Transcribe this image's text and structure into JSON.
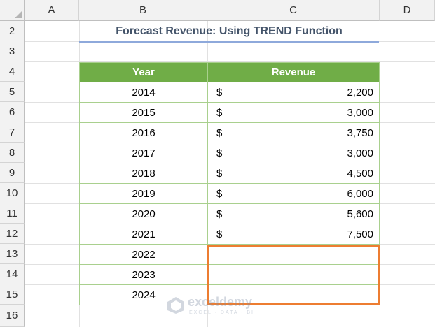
{
  "sheet": {
    "columns": [
      "A",
      "B",
      "C",
      "D"
    ],
    "rows": [
      "2",
      "3",
      "4",
      "5",
      "6",
      "7",
      "8",
      "9",
      "10",
      "11",
      "12",
      "13",
      "14",
      "15",
      "16"
    ]
  },
  "title": "Forecast Revenue: Using TREND Function",
  "table": {
    "headers": {
      "year": "Year",
      "revenue": "Revenue"
    },
    "currency_symbol": "$",
    "rows": [
      {
        "year": "2014",
        "revenue": "2,200"
      },
      {
        "year": "2015",
        "revenue": "3,000"
      },
      {
        "year": "2016",
        "revenue": "3,750"
      },
      {
        "year": "2017",
        "revenue": "3,000"
      },
      {
        "year": "2018",
        "revenue": "4,500"
      },
      {
        "year": "2019",
        "revenue": "6,000"
      },
      {
        "year": "2020",
        "revenue": "5,600"
      },
      {
        "year": "2021",
        "revenue": "7,500"
      },
      {
        "year": "2022",
        "revenue": ""
      },
      {
        "year": "2023",
        "revenue": ""
      },
      {
        "year": "2024",
        "revenue": ""
      }
    ]
  },
  "watermark": {
    "name": "exceldemy",
    "tagline": "EXCEL · DATA · BI"
  },
  "colors": {
    "header_green": "#70ad47",
    "selection_orange": "#ed7d31",
    "title_color": "#44546a"
  }
}
